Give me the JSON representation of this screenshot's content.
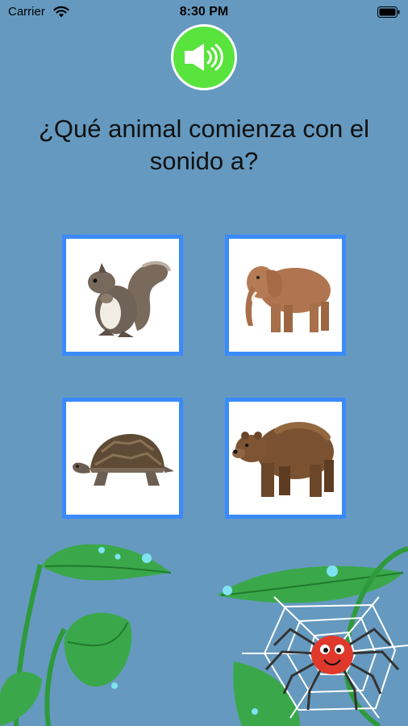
{
  "status_bar": {
    "carrier": "Carrier",
    "time": "8:30 PM"
  },
  "audio_button": {
    "icon": "speaker-icon",
    "color": "#59e33d"
  },
  "question": {
    "text": "¿Qué animal comienza con el sonido a?"
  },
  "options": [
    {
      "animal": "squirrel",
      "icon": "squirrel-image"
    },
    {
      "animal": "elephant",
      "icon": "elephant-image"
    },
    {
      "animal": "turtle",
      "icon": "turtle-image"
    },
    {
      "animal": "bear",
      "icon": "bear-image"
    }
  ],
  "colors": {
    "background": "#6599bf",
    "card_border": "#3a8afc",
    "leaf": "#2e9a3c"
  }
}
